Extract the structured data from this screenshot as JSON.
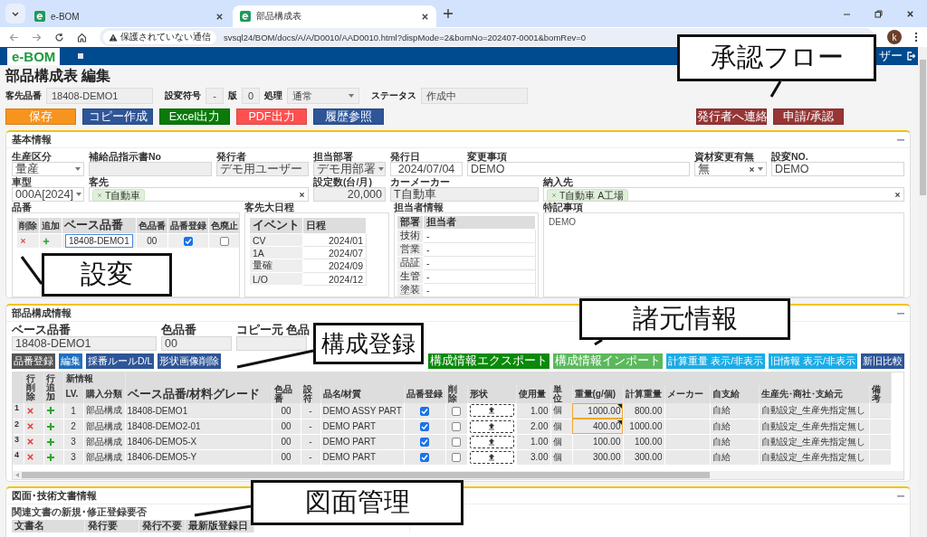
{
  "browser": {
    "tabs": [
      {
        "title": "e-BOM",
        "selected": false
      },
      {
        "title": "部品構成表",
        "selected": true
      }
    ],
    "security_warning": "保護されていない通信",
    "url": "svsql24/BOM/docs/A/A/D0010/AAD0010.html?dispMode=2&bomNo=202407-0001&bomRev=0",
    "profile_initial": "k"
  },
  "app_bar": {
    "logo": "e-BOM",
    "user": "ザー"
  },
  "page_title": "部品構成表 編集",
  "header_fields": [
    {
      "label": "客先品番",
      "value": "18408-DEMO1",
      "kind": "text"
    },
    {
      "label": "設変符号",
      "value": "-",
      "kind": "short"
    },
    {
      "label": "版",
      "value": "0",
      "kind": "short"
    },
    {
      "label": "処理",
      "value": "通常",
      "kind": "select"
    },
    {
      "label": "ステータス",
      "value": "作成中",
      "kind": "text"
    }
  ],
  "actions": [
    {
      "label": "保存",
      "color": "#f7941d"
    },
    {
      "label": "コピー作成",
      "color": "#2e5597"
    },
    {
      "label": "Excel出力",
      "color": "#0a7a0a"
    },
    {
      "label": "PDF出力",
      "color": "#ff5050"
    },
    {
      "label": "履歴参照",
      "color": "#2e5597"
    }
  ],
  "flow_actions": [
    {
      "label": "発行者へ連絡",
      "color": "#973535"
    },
    {
      "label": "申請/承認",
      "color": "#973535"
    }
  ],
  "basic_info": {
    "title": "基本情報",
    "fields": [
      {
        "label": "生産区分",
        "kind": "select",
        "value": "量産",
        "readonly": false
      },
      {
        "label": "補給品指示書No",
        "kind": "text",
        "readonly": true
      },
      {
        "label": "発行者",
        "kind": "text",
        "value": "デモ用ユーザー",
        "readonly": true
      },
      {
        "label": "担当部署",
        "kind": "select",
        "value": "デモ用部署",
        "readonly": true
      },
      {
        "label": "発行日",
        "kind": "date",
        "value": "2024/07/04",
        "readonly": false
      },
      {
        "label": "変更事項",
        "kind": "text",
        "value": "DEMO",
        "readonly": false
      },
      {
        "label": "資材変更有無",
        "kind": "clearselect",
        "value": "無",
        "readonly": false
      },
      {
        "label": "設変NO.",
        "kind": "text",
        "value": "DEMO",
        "readonly": false
      },
      {
        "label": "車型",
        "kind": "select",
        "value": "000A[2024]",
        "readonly": false
      },
      {
        "label": "客先",
        "kind": "tags",
        "tags": [
          "T自動車"
        ],
        "readonly": false
      },
      {
        "label": "設定数(台/月)",
        "kind": "number",
        "value": "20,000",
        "readonly": true
      },
      {
        "label": "カーメーカー",
        "kind": "text",
        "value": "T自動車",
        "readonly": true
      },
      {
        "label": "納入先",
        "kind": "tags",
        "tags": [
          "T自動車 A工場"
        ],
        "readonly": false
      }
    ],
    "part_numbers": {
      "title": "品番",
      "columns": [
        "削除",
        "追加",
        "ベース品番",
        "色品番",
        "品番登録",
        "色廃止"
      ],
      "rows": [
        {
          "base_part": "18408-DEMO1",
          "color_no": "00",
          "registered": true,
          "color_discontinued": false
        }
      ]
    },
    "schedule": {
      "title": "客先大日程",
      "columns": [
        "イベント",
        "日程"
      ],
      "rows": [
        [
          "CV",
          "2024/01"
        ],
        [
          "1A",
          "2024/07"
        ],
        [
          "量確",
          "2024/09"
        ],
        [
          "L/O",
          "2024/12"
        ]
      ]
    },
    "staff": {
      "title": "担当者情報",
      "columns": [
        "部署",
        "担当者"
      ],
      "rows": [
        [
          "技術",
          "-"
        ],
        [
          "営業",
          "-"
        ],
        [
          "品証",
          "-"
        ],
        [
          "生管",
          "-"
        ],
        [
          "塗装",
          "-"
        ]
      ]
    },
    "notes": {
      "title": "特記事項",
      "value": "DEMO"
    }
  },
  "parts": {
    "title": "部品構成情報",
    "fields": [
      {
        "label": "ベース品番",
        "value": "18408-DEMO1"
      },
      {
        "label": "色品番",
        "value": "00"
      },
      {
        "label": "コピー元 色品"
      }
    ],
    "left_buttons": [
      {
        "label": "品番登録",
        "color": "#555555"
      },
      {
        "label": "編集",
        "color": "#1f6fbf"
      },
      {
        "label": "採番ルールD/L",
        "color": "#2e5597"
      },
      {
        "label": "形状画像削除",
        "color": "#2e5597"
      }
    ],
    "right_buttons": [
      {
        "label": "構成情報エクスポート",
        "color": "#0a8a0a"
      },
      {
        "label": "構成情報インポート",
        "color": "#5cb85c"
      },
      {
        "label": "計算重量 表示/非表示",
        "color": "#1aace6"
      },
      {
        "label": "旧情報 表示/非表示",
        "color": "#1aace6"
      },
      {
        "label": "新旧比較",
        "color": "#2e5597"
      }
    ],
    "row_action_columns": [
      "行削除",
      "行追加"
    ],
    "group_header": "新情報",
    "columns": [
      "LV.",
      "購入分類",
      "ベース品番/材料グレード",
      "色品番",
      "設符",
      "品名/材質",
      "品番登録",
      "削除",
      "形状",
      "使用量",
      "単位",
      "重量(g/個)",
      "計算重量",
      "メーカー",
      "自支給",
      "生産先･商社･支給元",
      "備考"
    ],
    "rows": [
      {
        "no": "1",
        "lv": "1",
        "purchase_type": "部品構成",
        "base_part": "18408-DEMO1",
        "color_no": "00",
        "change_code": "-",
        "name": "DEMO ASSY PART",
        "registered": true,
        "deleted": false,
        "quantity": "1.00",
        "unit": "個",
        "weight": "1000.00",
        "weight_modified": true,
        "calc_weight": "800.00",
        "supply": "自給",
        "source": "自動設定_生産先指定無し"
      },
      {
        "no": "2",
        "lv": "2",
        "purchase_type": "部品構成",
        "base_part": "18408-DEMO2-01",
        "color_no": "00",
        "change_code": "-",
        "name": "DEMO PART",
        "registered": true,
        "deleted": false,
        "quantity": "2.00",
        "unit": "個",
        "weight": "400.00",
        "weight_modified": true,
        "calc_weight": "1000.00",
        "supply": "自給",
        "source": "自動設定_生産先指定無し"
      },
      {
        "no": "3",
        "lv": "3",
        "purchase_type": "部品構成",
        "base_part": "18406-DEMO5-X",
        "color_no": "00",
        "change_code": "-",
        "name": "DEMO PART",
        "registered": true,
        "deleted": false,
        "quantity": "1.00",
        "unit": "個",
        "weight": "100.00",
        "weight_modified": false,
        "calc_weight": "100.00",
        "supply": "自給",
        "source": "自動設定_生産先指定無し"
      },
      {
        "no": "4",
        "lv": "3",
        "purchase_type": "部品構成",
        "base_part": "18406-DEMO5-Y",
        "color_no": "00",
        "change_code": "-",
        "name": "DEMO PART",
        "registered": true,
        "deleted": false,
        "quantity": "3.00",
        "unit": "個",
        "weight": "300.00",
        "weight_modified": false,
        "calc_weight": "300.00",
        "supply": "自給",
        "source": "自動設定_生産先指定無し"
      }
    ]
  },
  "documents": {
    "title": "図面･技術文書情報",
    "subtitle": "関連文書の新規･修正登録要否",
    "columns": [
      "文書名",
      "発行要",
      "発行不要",
      "最新版登録日"
    ]
  },
  "callouts": [
    {
      "text": "承認フロー"
    },
    {
      "text": "設変"
    },
    {
      "text": "構成登録"
    },
    {
      "text": "諸元情報"
    },
    {
      "text": "図面管理"
    }
  ]
}
